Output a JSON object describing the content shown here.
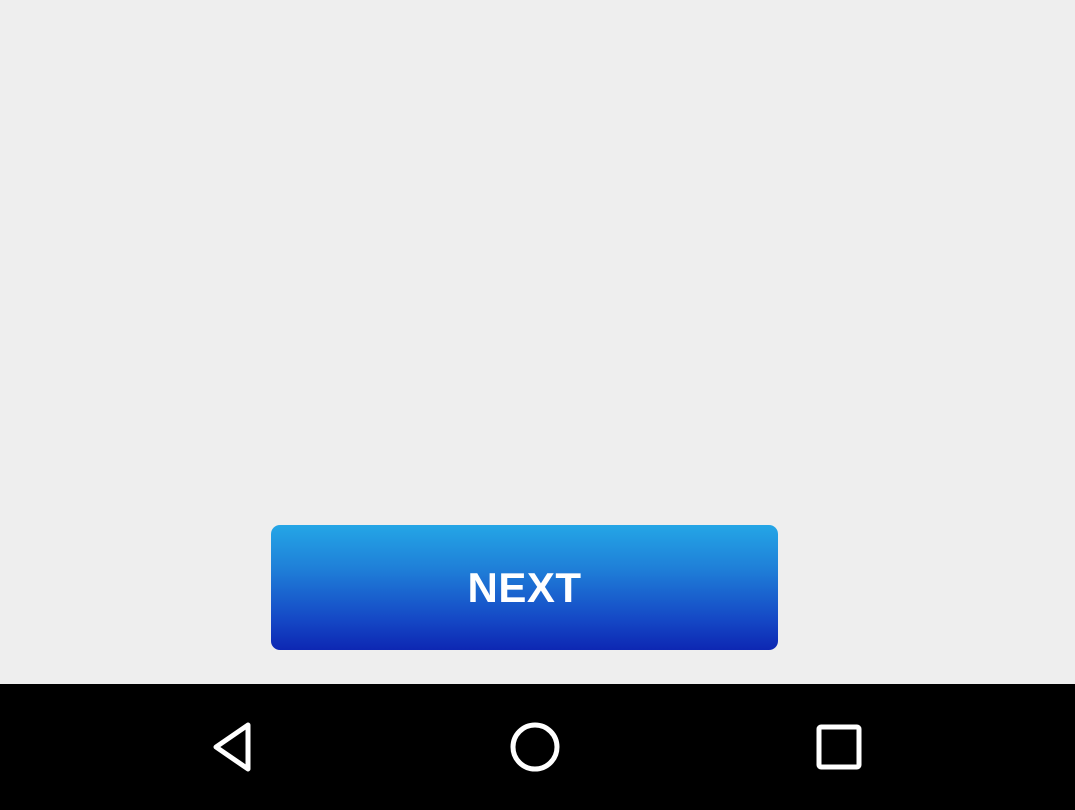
{
  "main": {
    "next_button_label": "NEXT"
  },
  "nav_bar": {
    "buttons": [
      {
        "name": "back",
        "icon": "back-triangle-icon"
      },
      {
        "name": "home",
        "icon": "home-circle-icon"
      },
      {
        "name": "recents",
        "icon": "recents-square-icon"
      }
    ]
  },
  "colors": {
    "background": "#eeeeee",
    "button_top": "#24a6e6",
    "button_bottom": "#0d27b3",
    "button_text": "#ffffff",
    "nav_bar": "#000000",
    "nav_icon": "#ffffff"
  }
}
